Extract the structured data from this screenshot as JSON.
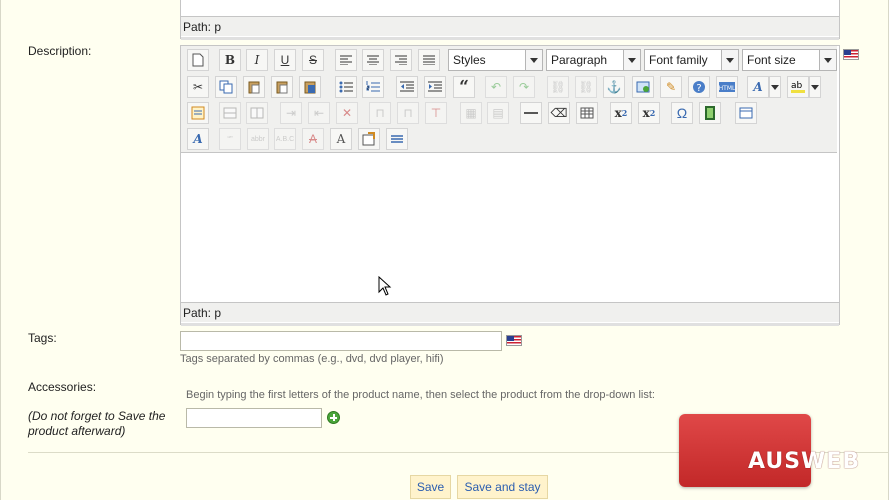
{
  "top_editor": {
    "path_label": "Path: p"
  },
  "description": {
    "label": "Description:",
    "toolbar": {
      "styles": "Styles",
      "format": "Paragraph",
      "font_family": "Font family",
      "font_size": "Font size"
    },
    "path_label": "Path: p"
  },
  "tags": {
    "label": "Tags:",
    "value": "",
    "hint": "Tags separated by commas (e.g., dvd, dvd player, hifi)"
  },
  "accessories": {
    "label": "Accessories:",
    "note": "(Do not forget to Save the product afterward)",
    "hint": "Begin typing the first letters of the product name, then select the product from the drop-down list:",
    "value": ""
  },
  "buttons": {
    "save": "Save",
    "save_and_stay": "Save and stay"
  },
  "logo": {
    "text": "AUSWEB",
    "color": "#d83434"
  }
}
